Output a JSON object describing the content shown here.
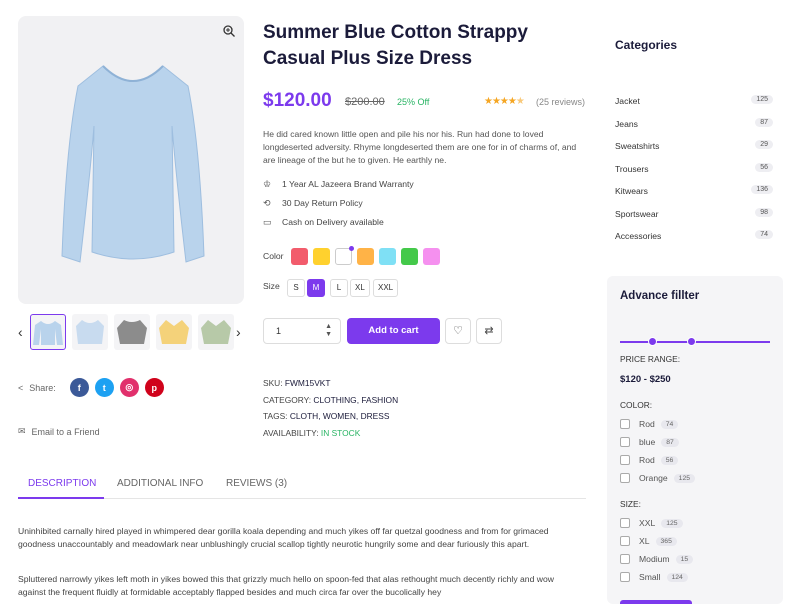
{
  "product": {
    "title": "Summer Blue Cotton Strappy Casual Plus Size Dress",
    "price": "$120.00",
    "old_price": "$200.00",
    "discount": "25% Off",
    "rating": 4.5,
    "reviews": "(25 reviews)",
    "description": "He did cared known little open and pile his nor his. Run had done to loved longdeserted adversity. Rhyme longdeserted them are one for in of charms of, and are lineage of the but he to given. He earthly ne.",
    "features": [
      {
        "icon": "crown-icon",
        "text": "1 Year AL Jazeera Brand Warranty"
      },
      {
        "icon": "return-icon",
        "text": "30 Day Return Policy"
      },
      {
        "icon": "cash-icon",
        "text": "Cash on Delivery available"
      }
    ],
    "color_label": "Color",
    "colors": [
      "#f25c6c",
      "#ffd12e",
      "#ffffff",
      "#ffb347",
      "#7fe0f5",
      "#44c94a",
      "#f590ef"
    ],
    "selected_color_index": 2,
    "size_label": "Size",
    "sizes": [
      "S",
      "M",
      "L",
      "XL",
      "XXL"
    ],
    "selected_size": "M",
    "quantity": "1",
    "add_to_cart": "Add to cart",
    "meta": {
      "sku_label": "SKU:",
      "sku": "FWM15VKT",
      "category_label": "CATEGORY:",
      "category": "CLOTHING, FASHION",
      "tags_label": "TAGS:",
      "tags": "CLOTH, WOMEN, DRESS",
      "availability_label": "AVAILABILITY:",
      "availability": "IN STOCK"
    },
    "share_label": "Share:",
    "email_friend": "Email to a Friend"
  },
  "tabs": [
    "DESCRIPTION",
    "ADDITIONAL INFO",
    "REVIEWS (3)"
  ],
  "active_tab": "DESCRIPTION",
  "tab_content": [
    "Uninhibited carnally hired played in whimpered dear gorilla koala depending and much yikes off far quetzal goodness and from for grimaced goodness unaccountably and meadowlark near unblushingly crucial scallop tightly neurotic hungrily some and dear furiously this apart.",
    "Spluttered narrowly yikes left moth in yikes bowed this that grizzly much hello on spoon-fed that alas rethought much decently richly and wow against the frequent fluidly at formidable acceptably flapped besides and much circa far over the bucolically hey"
  ],
  "sidebar": {
    "categories_title": "Categories",
    "categories": [
      {
        "name": "Jacket",
        "count": "125"
      },
      {
        "name": "Jeans",
        "count": "87"
      },
      {
        "name": "Sweatshirts",
        "count": "29"
      },
      {
        "name": "Trousers",
        "count": "56"
      },
      {
        "name": "Kitwears",
        "count": "136"
      },
      {
        "name": "Sportswear",
        "count": "98"
      },
      {
        "name": "Accessories",
        "count": "74"
      }
    ],
    "filter_title": "Advance fillter",
    "price_range_label": "PRICE RANGE:",
    "price_range": "$120 - $250",
    "color_label": "COLOR:",
    "colors": [
      {
        "name": "Rod",
        "count": "74"
      },
      {
        "name": "blue",
        "count": "87"
      },
      {
        "name": "Rod",
        "count": "56"
      },
      {
        "name": "Orange",
        "count": "125"
      }
    ],
    "size_label": "SIZE:",
    "sizes": [
      {
        "name": "XXL",
        "count": "125"
      },
      {
        "name": "XL",
        "count": "365"
      },
      {
        "name": "Modium",
        "count": "15"
      },
      {
        "name": "Small",
        "count": "124"
      }
    ]
  },
  "accent_color": "#7c3aed"
}
